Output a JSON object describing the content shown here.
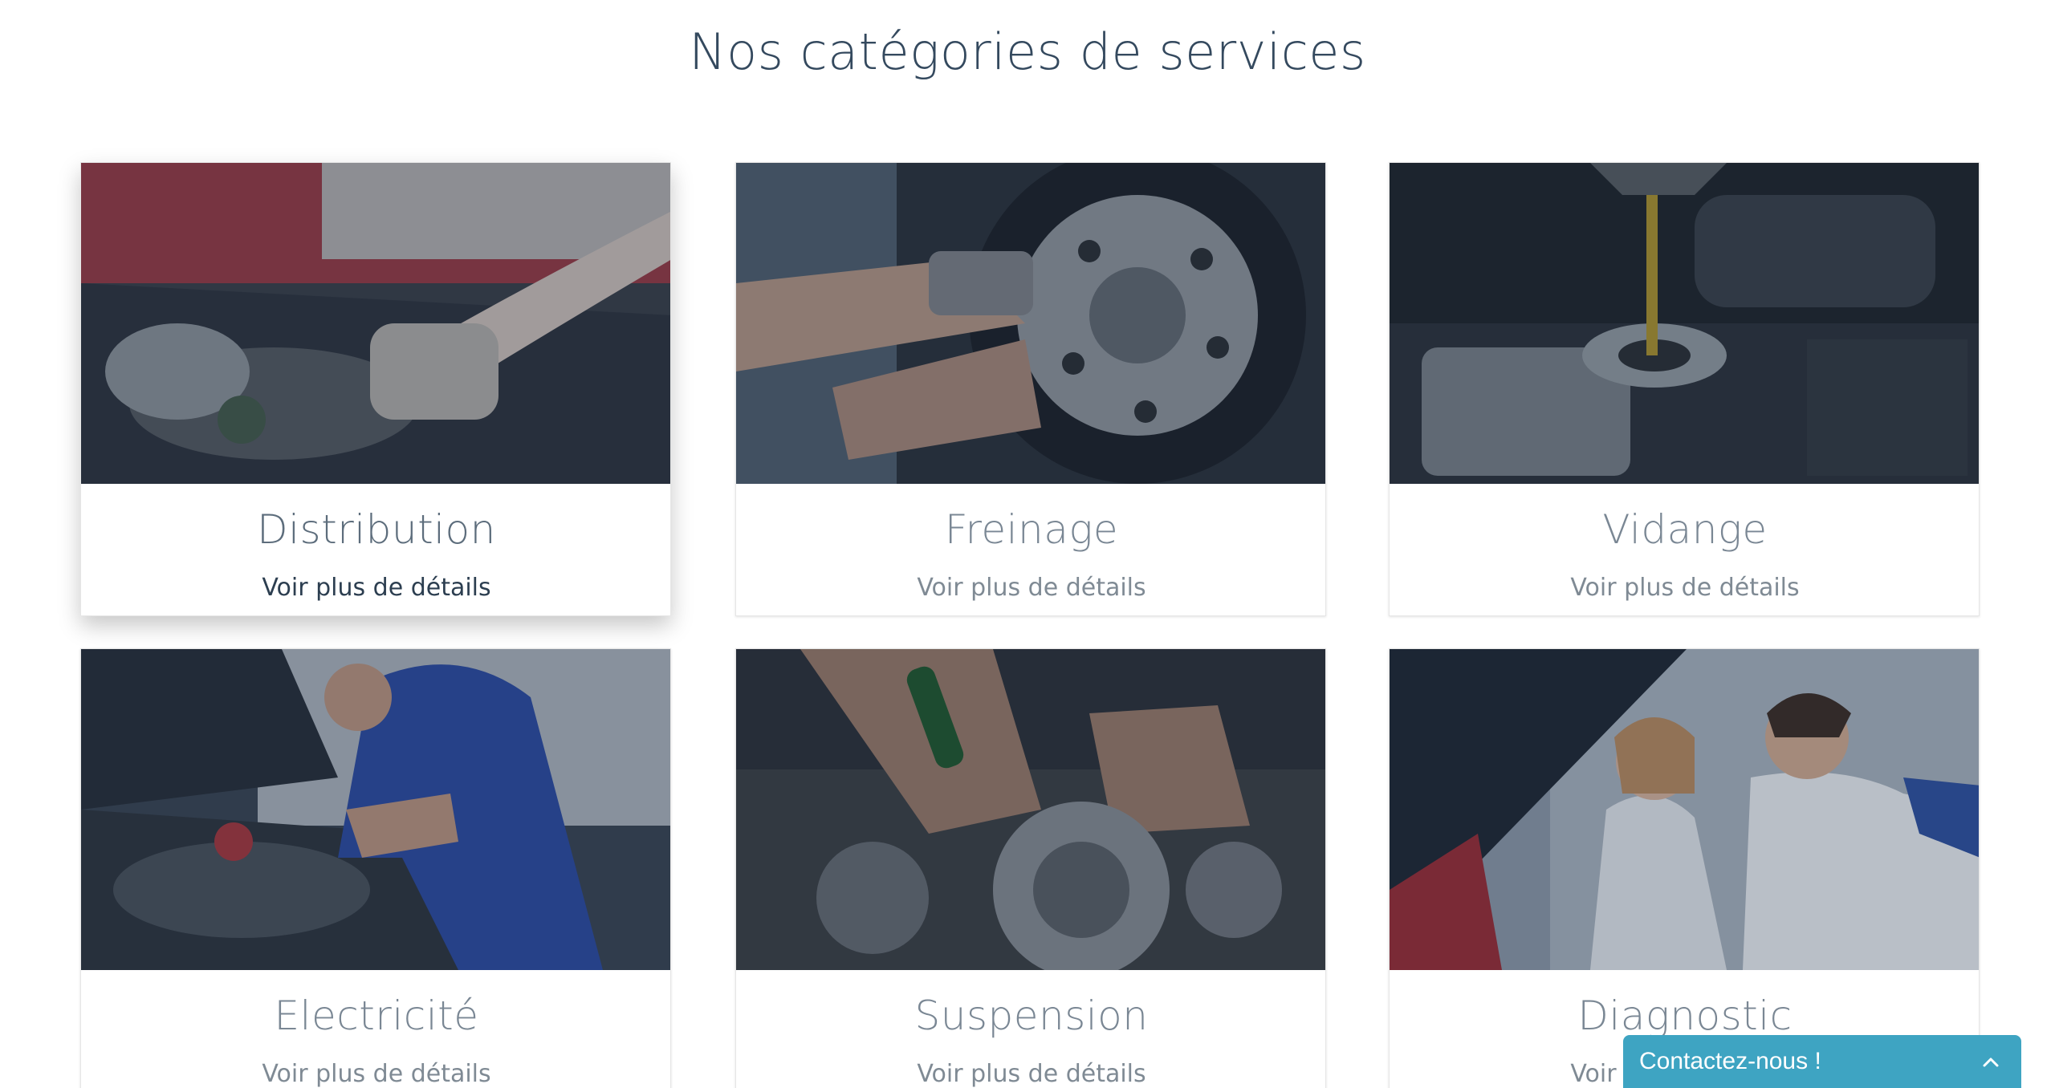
{
  "section": {
    "title": "Nos catégories de services"
  },
  "cards": [
    {
      "title": "Distribution",
      "link": "Voir plus de détails",
      "image": "engine-mechanic-photo",
      "hovered": true
    },
    {
      "title": "Freinage",
      "link": "Voir plus de détails",
      "image": "wheel-impact-wrench-photo",
      "hovered": false
    },
    {
      "title": "Vidange",
      "link": "Voir plus de détails",
      "image": "oil-pour-engine-photo",
      "hovered": false
    },
    {
      "title": "Electricité",
      "link": "Voir plus de détails",
      "image": "mechanic-under-hood-photo",
      "hovered": false
    },
    {
      "title": "Suspension",
      "link": "Voir plus de détails",
      "image": "gearbox-repair-photo",
      "hovered": false
    },
    {
      "title": "Diagnostic",
      "link": "Voir plus de détails",
      "image": "mechanic-customer-photo",
      "hovered": false
    }
  ],
  "contact_widget": {
    "label": "Contactez-nous !",
    "icon": "chevron-up-icon"
  },
  "colors": {
    "title": "#34495e",
    "card_title": "#7a8794",
    "contact_bg": "#3ea4c2",
    "image_overlay": "#1c2b40"
  }
}
